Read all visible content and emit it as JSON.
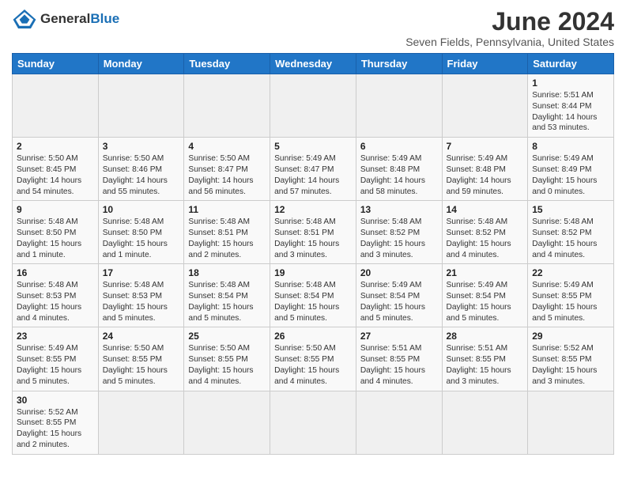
{
  "logo": {
    "general": "General",
    "blue": "Blue"
  },
  "title": "June 2024",
  "location": "Seven Fields, Pennsylvania, United States",
  "days_of_week": [
    "Sunday",
    "Monday",
    "Tuesday",
    "Wednesday",
    "Thursday",
    "Friday",
    "Saturday"
  ],
  "weeks": [
    [
      {
        "day": "",
        "info": ""
      },
      {
        "day": "",
        "info": ""
      },
      {
        "day": "",
        "info": ""
      },
      {
        "day": "",
        "info": ""
      },
      {
        "day": "",
        "info": ""
      },
      {
        "day": "",
        "info": ""
      },
      {
        "day": "1",
        "info": "Sunrise: 5:51 AM\nSunset: 8:44 PM\nDaylight: 14 hours\nand 53 minutes."
      }
    ],
    [
      {
        "day": "2",
        "info": "Sunrise: 5:50 AM\nSunset: 8:45 PM\nDaylight: 14 hours\nand 54 minutes."
      },
      {
        "day": "3",
        "info": "Sunrise: 5:50 AM\nSunset: 8:46 PM\nDaylight: 14 hours\nand 55 minutes."
      },
      {
        "day": "4",
        "info": "Sunrise: 5:50 AM\nSunset: 8:47 PM\nDaylight: 14 hours\nand 56 minutes."
      },
      {
        "day": "5",
        "info": "Sunrise: 5:49 AM\nSunset: 8:47 PM\nDaylight: 14 hours\nand 57 minutes."
      },
      {
        "day": "6",
        "info": "Sunrise: 5:49 AM\nSunset: 8:48 PM\nDaylight: 14 hours\nand 58 minutes."
      },
      {
        "day": "7",
        "info": "Sunrise: 5:49 AM\nSunset: 8:48 PM\nDaylight: 14 hours\nand 59 minutes."
      },
      {
        "day": "8",
        "info": "Sunrise: 5:49 AM\nSunset: 8:49 PM\nDaylight: 15 hours\nand 0 minutes."
      }
    ],
    [
      {
        "day": "9",
        "info": "Sunrise: 5:48 AM\nSunset: 8:50 PM\nDaylight: 15 hours\nand 1 minute."
      },
      {
        "day": "10",
        "info": "Sunrise: 5:48 AM\nSunset: 8:50 PM\nDaylight: 15 hours\nand 1 minute."
      },
      {
        "day": "11",
        "info": "Sunrise: 5:48 AM\nSunset: 8:51 PM\nDaylight: 15 hours\nand 2 minutes."
      },
      {
        "day": "12",
        "info": "Sunrise: 5:48 AM\nSunset: 8:51 PM\nDaylight: 15 hours\nand 3 minutes."
      },
      {
        "day": "13",
        "info": "Sunrise: 5:48 AM\nSunset: 8:52 PM\nDaylight: 15 hours\nand 3 minutes."
      },
      {
        "day": "14",
        "info": "Sunrise: 5:48 AM\nSunset: 8:52 PM\nDaylight: 15 hours\nand 4 minutes."
      },
      {
        "day": "15",
        "info": "Sunrise: 5:48 AM\nSunset: 8:52 PM\nDaylight: 15 hours\nand 4 minutes."
      }
    ],
    [
      {
        "day": "16",
        "info": "Sunrise: 5:48 AM\nSunset: 8:53 PM\nDaylight: 15 hours\nand 4 minutes."
      },
      {
        "day": "17",
        "info": "Sunrise: 5:48 AM\nSunset: 8:53 PM\nDaylight: 15 hours\nand 5 minutes."
      },
      {
        "day": "18",
        "info": "Sunrise: 5:48 AM\nSunset: 8:54 PM\nDaylight: 15 hours\nand 5 minutes."
      },
      {
        "day": "19",
        "info": "Sunrise: 5:48 AM\nSunset: 8:54 PM\nDaylight: 15 hours\nand 5 minutes."
      },
      {
        "day": "20",
        "info": "Sunrise: 5:49 AM\nSunset: 8:54 PM\nDaylight: 15 hours\nand 5 minutes."
      },
      {
        "day": "21",
        "info": "Sunrise: 5:49 AM\nSunset: 8:54 PM\nDaylight: 15 hours\nand 5 minutes."
      },
      {
        "day": "22",
        "info": "Sunrise: 5:49 AM\nSunset: 8:55 PM\nDaylight: 15 hours\nand 5 minutes."
      }
    ],
    [
      {
        "day": "23",
        "info": "Sunrise: 5:49 AM\nSunset: 8:55 PM\nDaylight: 15 hours\nand 5 minutes."
      },
      {
        "day": "24",
        "info": "Sunrise: 5:50 AM\nSunset: 8:55 PM\nDaylight: 15 hours\nand 5 minutes."
      },
      {
        "day": "25",
        "info": "Sunrise: 5:50 AM\nSunset: 8:55 PM\nDaylight: 15 hours\nand 4 minutes."
      },
      {
        "day": "26",
        "info": "Sunrise: 5:50 AM\nSunset: 8:55 PM\nDaylight: 15 hours\nand 4 minutes."
      },
      {
        "day": "27",
        "info": "Sunrise: 5:51 AM\nSunset: 8:55 PM\nDaylight: 15 hours\nand 4 minutes."
      },
      {
        "day": "28",
        "info": "Sunrise: 5:51 AM\nSunset: 8:55 PM\nDaylight: 15 hours\nand 3 minutes."
      },
      {
        "day": "29",
        "info": "Sunrise: 5:52 AM\nSunset: 8:55 PM\nDaylight: 15 hours\nand 3 minutes."
      }
    ],
    [
      {
        "day": "30",
        "info": "Sunrise: 5:52 AM\nSunset: 8:55 PM\nDaylight: 15 hours\nand 2 minutes."
      },
      {
        "day": "",
        "info": ""
      },
      {
        "day": "",
        "info": ""
      },
      {
        "day": "",
        "info": ""
      },
      {
        "day": "",
        "info": ""
      },
      {
        "day": "",
        "info": ""
      },
      {
        "day": "",
        "info": ""
      }
    ]
  ]
}
